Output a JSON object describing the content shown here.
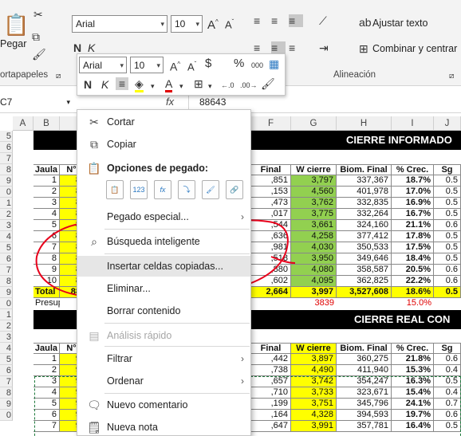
{
  "ribbon": {
    "paste_label": "Pegar",
    "clipboard_group": "ortapapeles",
    "font_name": "Arial",
    "font_size": "10",
    "wrap_text": "Ajustar texto",
    "merge_center": "Combinar y centrar",
    "alignment_group": "Alineación",
    "grow_font": "A^",
    "shrink_font": "A˅"
  },
  "minibar": {
    "font_name": "Arial",
    "font_size": "10",
    "bold": "N",
    "italic": "K",
    "percent": "%",
    "thousands": "000",
    "currency": "$"
  },
  "formula_bar": {
    "name_box": "C7",
    "fx": "fx",
    "value": "88643"
  },
  "columns": [
    "A",
    "B",
    "",
    "F",
    "G",
    "H",
    "I",
    "J"
  ],
  "rows": [
    "5",
    "6",
    "7",
    "8",
    "9",
    "0",
    "1",
    "2",
    "3",
    "4",
    "5",
    "6",
    "7",
    "8",
    "9",
    "0",
    "1",
    "2",
    "3",
    "4",
    "5",
    "6",
    "7",
    "8",
    "9",
    "0"
  ],
  "table1": {
    "banner": "CIERRE INFORMADO C",
    "headers": [
      "Jaula",
      "N°",
      "Final",
      "W cierre",
      "Biom. Final",
      "% Crec.",
      "Sg"
    ],
    "rows": [
      [
        "1",
        "8",
        ",851",
        "3,797",
        "337,367",
        "18.7%",
        "0.5"
      ],
      [
        "2",
        "8",
        ",153",
        "4,560",
        "401,978",
        "17.0%",
        "0.5"
      ],
      [
        "3",
        "8",
        ",473",
        "3,762",
        "332,835",
        "16.9%",
        "0.5"
      ],
      [
        "4",
        "8",
        ",017",
        "3,775",
        "332,264",
        "16.7%",
        "0.5"
      ],
      [
        "5",
        "8",
        ",544",
        "3,661",
        "324,160",
        "21.1%",
        "0.6"
      ],
      [
        "6",
        "8",
        ",636",
        "4,258",
        "377,412",
        "17.8%",
        "0.5"
      ],
      [
        "7",
        "8",
        ",981",
        "4,030",
        "350,533",
        "17.5%",
        "0.5"
      ],
      [
        "8",
        "8",
        ",518",
        "3,950",
        "349,646",
        "18.4%",
        "0.5"
      ],
      [
        "9",
        "8",
        ",880",
        "4,080",
        "358,587",
        "20.5%",
        "0.6"
      ],
      [
        "10",
        "8",
        ",602",
        "4,095",
        "362,825",
        "22.2%",
        "0.6"
      ]
    ],
    "total": [
      "Total",
      "88",
      "2,664",
      "3,997",
      "3,527,608",
      "18.6%",
      "0.5"
    ],
    "presup": [
      "Presup",
      "",
      "",
      "3839",
      "",
      "15.0%",
      ""
    ]
  },
  "table2": {
    "banner": "CIERRE REAL CON GA",
    "headers": [
      "Jaula",
      "N°",
      "Final",
      "W cierre",
      "Biom. Final",
      "% Crec.",
      "Sg"
    ],
    "rows": [
      [
        "1",
        "9",
        ",442",
        "3,897",
        "360,275",
        "21.8%",
        "0.6"
      ],
      [
        "2",
        "9",
        ",738",
        "4,490",
        "411,940",
        "15.3%",
        "0.4"
      ],
      [
        "3",
        "9",
        ",657",
        "3,742",
        "354,247",
        "16.3%",
        "0.5"
      ],
      [
        "4",
        "9",
        ",710",
        "3,733",
        "323,671",
        "15.4%",
        "0.4"
      ],
      [
        "5",
        "9",
        ",199",
        "3,751",
        "345,796",
        "24.1%",
        "0.7"
      ],
      [
        "6",
        "9",
        ",164",
        "4,328",
        "394,593",
        "19.7%",
        "0.6"
      ],
      [
        "7",
        "9",
        ",647",
        "3,991",
        "357,781",
        "16.4%",
        "0.5"
      ]
    ]
  },
  "context_menu": {
    "items": [
      {
        "label": "Cortar",
        "icon": "scissors-icon"
      },
      {
        "label": "Copiar",
        "icon": "copy-icon"
      },
      {
        "label": "Opciones de pegado:",
        "icon": "clipboard-icon"
      },
      {
        "label": "Pegado especial...",
        "icon": ""
      },
      {
        "label": "Búsqueda inteligente",
        "icon": "search-icon"
      },
      {
        "label": "Insertar celdas copiadas...",
        "icon": ""
      },
      {
        "label": "Eliminar...",
        "icon": ""
      },
      {
        "label": "Borrar contenido",
        "icon": ""
      },
      {
        "label": "Análisis rápido",
        "icon": "quick-analysis-icon"
      },
      {
        "label": "Filtrar",
        "icon": ""
      },
      {
        "label": "Ordenar",
        "icon": ""
      },
      {
        "label": "Nuevo comentario",
        "icon": "comment-icon"
      },
      {
        "label": "Nueva nota",
        "icon": "note-icon"
      }
    ],
    "paste_options": [
      "paste",
      "123",
      "fx",
      "transpose",
      "format",
      "link"
    ]
  },
  "colors": {
    "yellow": "#ffff00",
    "green_cell": "#ffff00",
    "red_annot": "#ff0000",
    "pct_red": "#ff0000"
  }
}
